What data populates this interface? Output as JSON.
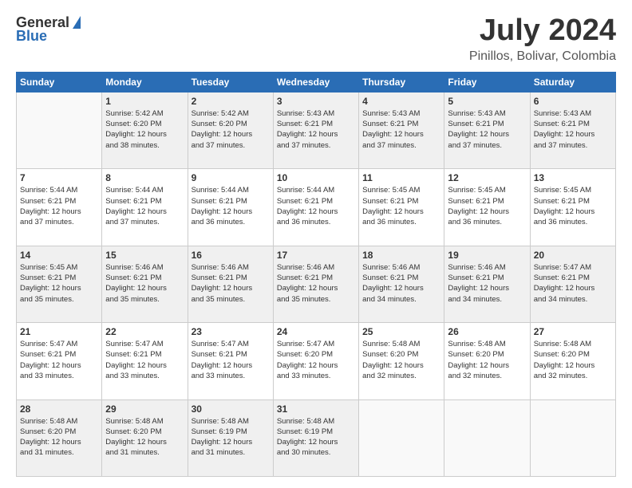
{
  "logo": {
    "general": "General",
    "blue": "Blue"
  },
  "title": {
    "month_year": "July 2024",
    "location": "Pinillos, Bolivar, Colombia"
  },
  "days_of_week": [
    "Sunday",
    "Monday",
    "Tuesday",
    "Wednesday",
    "Thursday",
    "Friday",
    "Saturday"
  ],
  "weeks": [
    [
      {
        "day": "",
        "info": ""
      },
      {
        "day": "1",
        "info": "Sunrise: 5:42 AM\nSunset: 6:20 PM\nDaylight: 12 hours\nand 38 minutes."
      },
      {
        "day": "2",
        "info": "Sunrise: 5:42 AM\nSunset: 6:20 PM\nDaylight: 12 hours\nand 37 minutes."
      },
      {
        "day": "3",
        "info": "Sunrise: 5:43 AM\nSunset: 6:21 PM\nDaylight: 12 hours\nand 37 minutes."
      },
      {
        "day": "4",
        "info": "Sunrise: 5:43 AM\nSunset: 6:21 PM\nDaylight: 12 hours\nand 37 minutes."
      },
      {
        "day": "5",
        "info": "Sunrise: 5:43 AM\nSunset: 6:21 PM\nDaylight: 12 hours\nand 37 minutes."
      },
      {
        "day": "6",
        "info": "Sunrise: 5:43 AM\nSunset: 6:21 PM\nDaylight: 12 hours\nand 37 minutes."
      }
    ],
    [
      {
        "day": "7",
        "info": "Sunrise: 5:44 AM\nSunset: 6:21 PM\nDaylight: 12 hours\nand 37 minutes."
      },
      {
        "day": "8",
        "info": "Sunrise: 5:44 AM\nSunset: 6:21 PM\nDaylight: 12 hours\nand 37 minutes."
      },
      {
        "day": "9",
        "info": "Sunrise: 5:44 AM\nSunset: 6:21 PM\nDaylight: 12 hours\nand 36 minutes."
      },
      {
        "day": "10",
        "info": "Sunrise: 5:44 AM\nSunset: 6:21 PM\nDaylight: 12 hours\nand 36 minutes."
      },
      {
        "day": "11",
        "info": "Sunrise: 5:45 AM\nSunset: 6:21 PM\nDaylight: 12 hours\nand 36 minutes."
      },
      {
        "day": "12",
        "info": "Sunrise: 5:45 AM\nSunset: 6:21 PM\nDaylight: 12 hours\nand 36 minutes."
      },
      {
        "day": "13",
        "info": "Sunrise: 5:45 AM\nSunset: 6:21 PM\nDaylight: 12 hours\nand 36 minutes."
      }
    ],
    [
      {
        "day": "14",
        "info": "Sunrise: 5:45 AM\nSunset: 6:21 PM\nDaylight: 12 hours\nand 35 minutes."
      },
      {
        "day": "15",
        "info": "Sunrise: 5:46 AM\nSunset: 6:21 PM\nDaylight: 12 hours\nand 35 minutes."
      },
      {
        "day": "16",
        "info": "Sunrise: 5:46 AM\nSunset: 6:21 PM\nDaylight: 12 hours\nand 35 minutes."
      },
      {
        "day": "17",
        "info": "Sunrise: 5:46 AM\nSunset: 6:21 PM\nDaylight: 12 hours\nand 35 minutes."
      },
      {
        "day": "18",
        "info": "Sunrise: 5:46 AM\nSunset: 6:21 PM\nDaylight: 12 hours\nand 34 minutes."
      },
      {
        "day": "19",
        "info": "Sunrise: 5:46 AM\nSunset: 6:21 PM\nDaylight: 12 hours\nand 34 minutes."
      },
      {
        "day": "20",
        "info": "Sunrise: 5:47 AM\nSunset: 6:21 PM\nDaylight: 12 hours\nand 34 minutes."
      }
    ],
    [
      {
        "day": "21",
        "info": "Sunrise: 5:47 AM\nSunset: 6:21 PM\nDaylight: 12 hours\nand 33 minutes."
      },
      {
        "day": "22",
        "info": "Sunrise: 5:47 AM\nSunset: 6:21 PM\nDaylight: 12 hours\nand 33 minutes."
      },
      {
        "day": "23",
        "info": "Sunrise: 5:47 AM\nSunset: 6:21 PM\nDaylight: 12 hours\nand 33 minutes."
      },
      {
        "day": "24",
        "info": "Sunrise: 5:47 AM\nSunset: 6:20 PM\nDaylight: 12 hours\nand 33 minutes."
      },
      {
        "day": "25",
        "info": "Sunrise: 5:48 AM\nSunset: 6:20 PM\nDaylight: 12 hours\nand 32 minutes."
      },
      {
        "day": "26",
        "info": "Sunrise: 5:48 AM\nSunset: 6:20 PM\nDaylight: 12 hours\nand 32 minutes."
      },
      {
        "day": "27",
        "info": "Sunrise: 5:48 AM\nSunset: 6:20 PM\nDaylight: 12 hours\nand 32 minutes."
      }
    ],
    [
      {
        "day": "28",
        "info": "Sunrise: 5:48 AM\nSunset: 6:20 PM\nDaylight: 12 hours\nand 31 minutes."
      },
      {
        "day": "29",
        "info": "Sunrise: 5:48 AM\nSunset: 6:20 PM\nDaylight: 12 hours\nand 31 minutes."
      },
      {
        "day": "30",
        "info": "Sunrise: 5:48 AM\nSunset: 6:19 PM\nDaylight: 12 hours\nand 31 minutes."
      },
      {
        "day": "31",
        "info": "Sunrise: 5:48 AM\nSunset: 6:19 PM\nDaylight: 12 hours\nand 30 minutes."
      },
      {
        "day": "",
        "info": ""
      },
      {
        "day": "",
        "info": ""
      },
      {
        "day": "",
        "info": ""
      }
    ]
  ]
}
